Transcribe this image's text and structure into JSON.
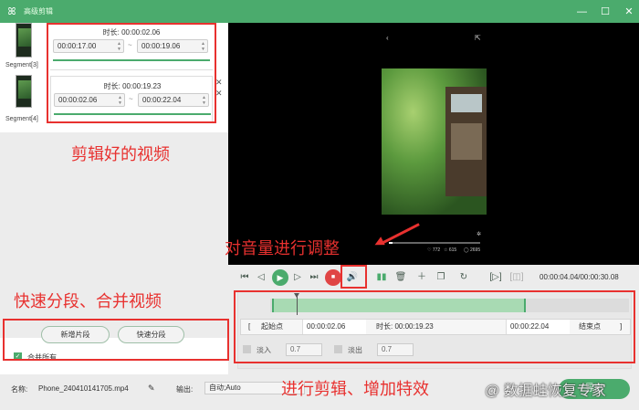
{
  "window": {
    "title": "高级剪辑"
  },
  "segments": [
    {
      "label": "Segment[3]",
      "duration_label": "时长:",
      "duration": "00:00:02.06",
      "start": "00:00:17.00",
      "end": "00:00:19.06"
    },
    {
      "label": "Segment[4]",
      "duration_label": "时长:",
      "duration": "00:00:19.23",
      "start": "00:00:02.06",
      "end": "00:00:22.04"
    }
  ],
  "segment_separator": "~",
  "left_panel": {
    "new_segment": "新增片段",
    "quick_split": "快速分段",
    "merge_all": "合并所有"
  },
  "player": {
    "current_time": "00:00:04.04/00:00:30.08",
    "stats": [
      "♡ 772",
      "☆ 615",
      "◯ 2695"
    ]
  },
  "timeline": {
    "start_btn": "起始点",
    "start": "00:00:02.06",
    "duration_label": "时长:",
    "duration": "00:00:19.23",
    "end": "00:00:22.04",
    "end_btn": "结束点",
    "fade_in": "淡入",
    "fade_in_value": "0.7",
    "fade_out": "淡出",
    "fade_out_value": "0.7"
  },
  "bottom": {
    "name_label": "名称:",
    "file_name": "Phone_240410141705.mp4",
    "output_label": "输出:",
    "output_value": "自动;Auto",
    "export_btn": "导出"
  },
  "annotations": {
    "edited_video": "剪辑好的视频",
    "volume": "对音量进行调整",
    "split_merge": "快速分段、合并视频",
    "effects": "进行剪辑、增加特效",
    "watermark": "@ 数据蛙恢复专家"
  },
  "colors": {
    "accent": "#4bab6d",
    "annotation": "#e8312f"
  }
}
